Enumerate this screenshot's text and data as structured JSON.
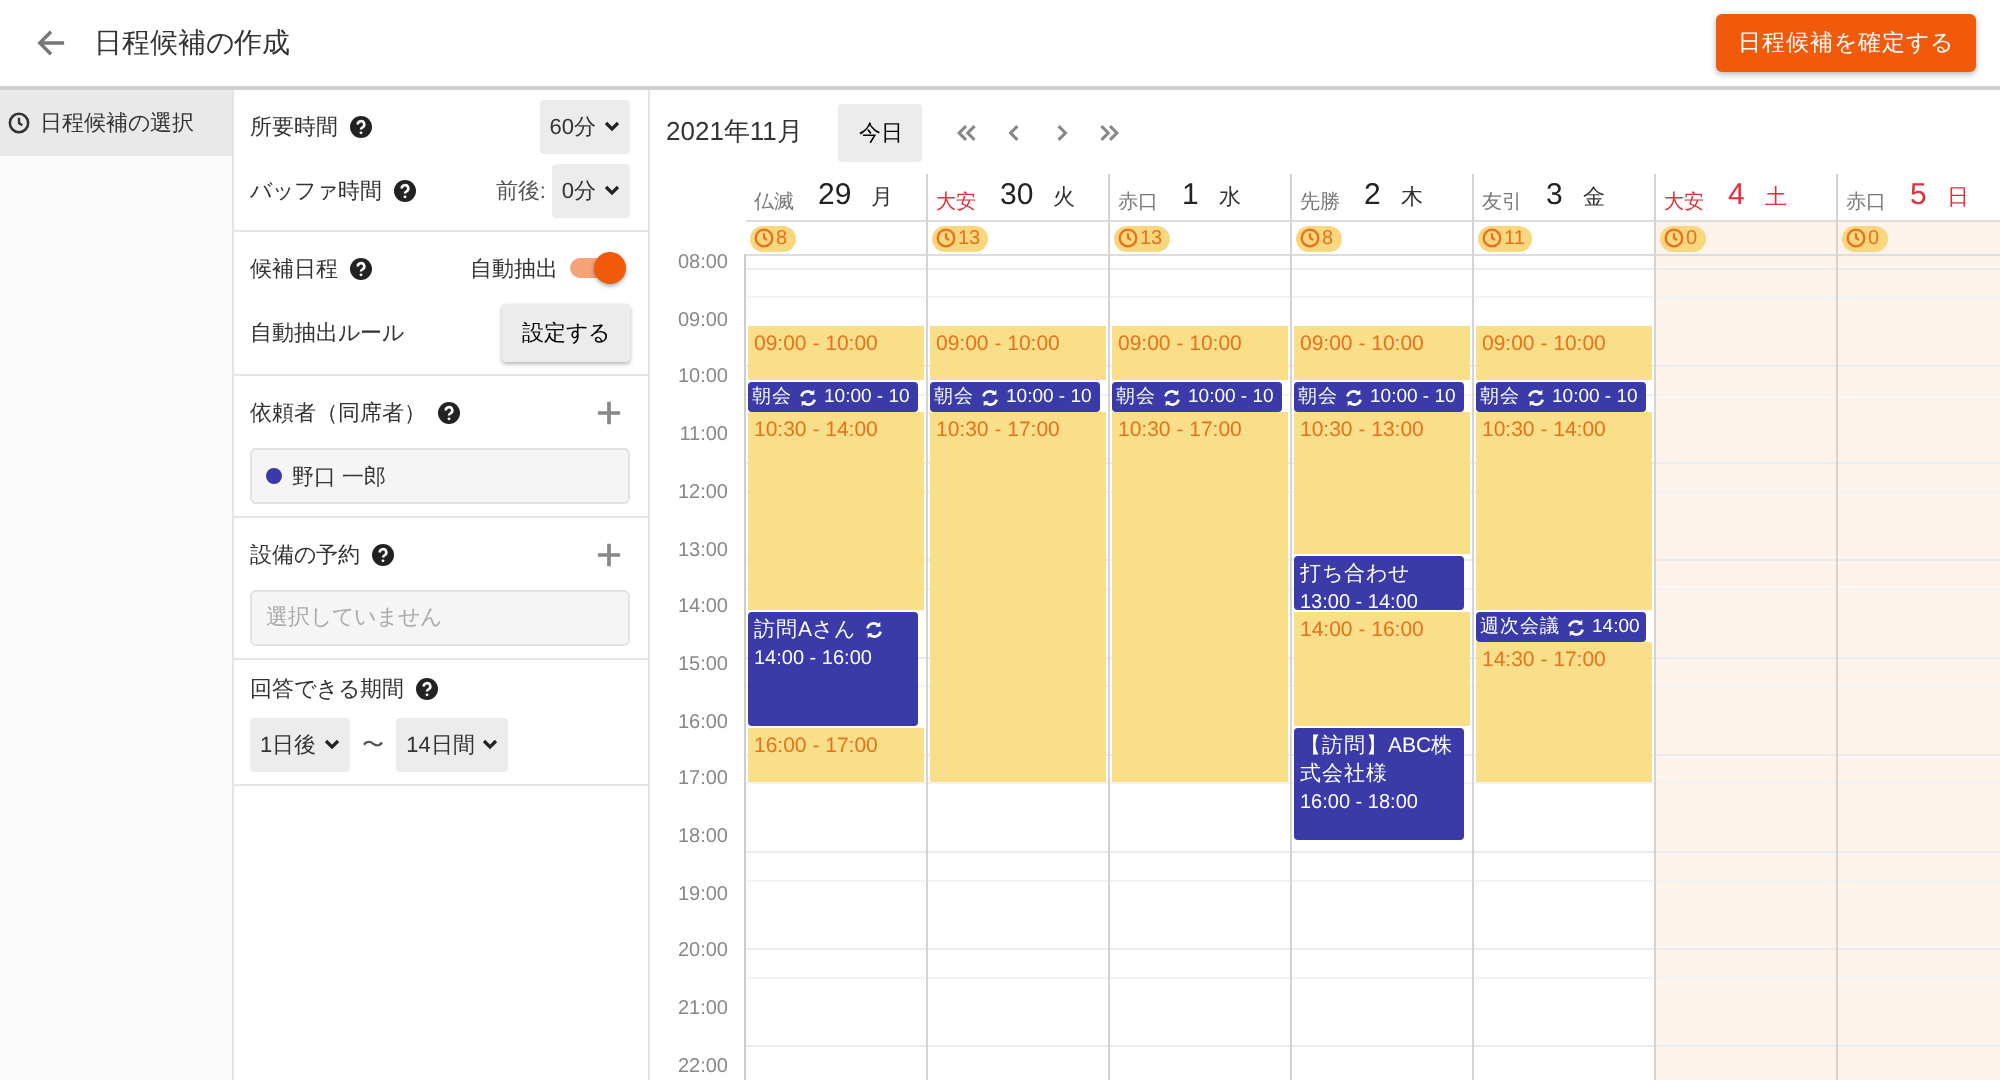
{
  "header": {
    "title": "日程候補の作成",
    "confirm_button": "日程候補を確定する"
  },
  "sidebar": {
    "items": [
      {
        "label": "日程候補の選択",
        "selected": true
      }
    ]
  },
  "settings": {
    "duration": {
      "label": "所要時間",
      "value": "60分"
    },
    "buffer": {
      "label": "バッファ時間",
      "prefix": "前後:",
      "value": "0分"
    },
    "candidates": {
      "label": "候補日程",
      "auto_label": "自動抽出",
      "auto_on": true,
      "rule_label": "自動抽出ルール",
      "rule_button": "設定する"
    },
    "requesters": {
      "label": "依頼者（同席者）",
      "people": [
        {
          "name": "野口 一郎",
          "color": "#3a3aa8"
        }
      ]
    },
    "facilities": {
      "label": "設備の予約",
      "placeholder": "選択していません"
    },
    "answer_period": {
      "label": "回答できる期間",
      "from": "1日後",
      "separator": "〜",
      "to": "14日間"
    }
  },
  "calendar": {
    "month": "2021年11月",
    "today_button": "今日",
    "time_labels": [
      "08:00",
      "09:00",
      "10:00",
      "11:00",
      "12:00",
      "13:00",
      "14:00",
      "15:00",
      "16:00",
      "17:00",
      "18:00",
      "19:00",
      "20:00",
      "21:00",
      "22:00"
    ],
    "days": [
      {
        "rokuyo": "仏滅",
        "lucky": false,
        "date": "29",
        "weekday": "月",
        "weekend": false,
        "count": "8",
        "events": [
          {
            "kind": "slot",
            "time": "09:00 - 10:00"
          },
          {
            "kind": "short_event",
            "title": "朝会",
            "recurring": true,
            "time": "10:00 - 10"
          },
          {
            "kind": "slot",
            "time": "10:30 - 14:00"
          },
          {
            "kind": "event",
            "title": "訪問Aさん",
            "recurring": true,
            "time": "14:00 - 16:00"
          },
          {
            "kind": "slot",
            "time": "16:00 - 17:00"
          }
        ]
      },
      {
        "rokuyo": "大安",
        "lucky": true,
        "date": "30",
        "weekday": "火",
        "weekend": false,
        "count": "13",
        "events": [
          {
            "kind": "slot",
            "time": "09:00 - 10:00"
          },
          {
            "kind": "short_event",
            "title": "朝会",
            "recurring": true,
            "time": "10:00 - 10"
          },
          {
            "kind": "slot",
            "time": "10:30 - 17:00"
          }
        ]
      },
      {
        "rokuyo": "赤口",
        "lucky": false,
        "date": "1",
        "weekday": "水",
        "weekend": false,
        "count": "13",
        "events": [
          {
            "kind": "slot",
            "time": "09:00 - 10:00"
          },
          {
            "kind": "short_event",
            "title": "朝会",
            "recurring": true,
            "time": "10:00 - 10"
          },
          {
            "kind": "slot",
            "time": "10:30 - 17:00"
          }
        ]
      },
      {
        "rokuyo": "先勝",
        "lucky": false,
        "date": "2",
        "weekday": "木",
        "weekend": false,
        "count": "8",
        "events": [
          {
            "kind": "slot",
            "time": "09:00 - 10:00"
          },
          {
            "kind": "short_event",
            "title": "朝会",
            "recurring": true,
            "time": "10:00 - 10"
          },
          {
            "kind": "slot",
            "time": "10:30 - 13:00"
          },
          {
            "kind": "event",
            "title": "打ち合わせ",
            "recurring": false,
            "time": "13:00 - 14:00"
          },
          {
            "kind": "slot",
            "time": "14:00 - 16:00"
          },
          {
            "kind": "event",
            "title": "【訪問】ABC株式会社様",
            "recurring": false,
            "time": "16:00 - 18:00"
          }
        ]
      },
      {
        "rokuyo": "友引",
        "lucky": false,
        "date": "3",
        "weekday": "金",
        "weekend": false,
        "count": "11",
        "events": [
          {
            "kind": "slot",
            "time": "09:00 - 10:00"
          },
          {
            "kind": "short_event",
            "title": "朝会",
            "recurring": true,
            "time": "10:00 - 10"
          },
          {
            "kind": "slot",
            "time": "10:30 - 14:00"
          },
          {
            "kind": "short_event",
            "title": "週次会議",
            "recurring": true,
            "time": "14:00"
          },
          {
            "kind": "slot",
            "time": "14:30 - 17:00"
          }
        ]
      },
      {
        "rokuyo": "大安",
        "lucky": true,
        "date": "4",
        "weekday": "土",
        "weekend": true,
        "count": "0"
      },
      {
        "rokuyo": "赤口",
        "lucky": false,
        "date": "5",
        "weekday": "日",
        "weekend": true,
        "count": "0"
      }
    ]
  }
}
